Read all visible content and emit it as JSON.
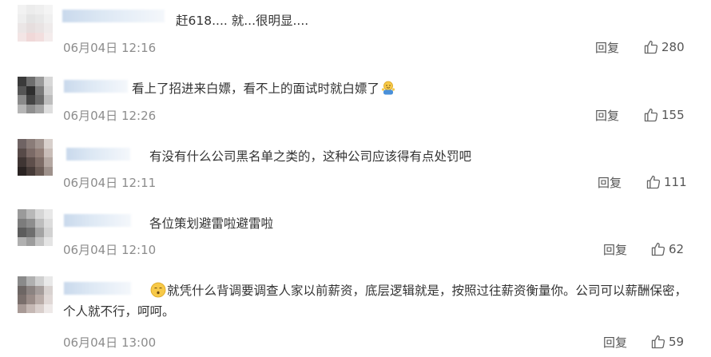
{
  "comments": [
    {
      "text": "赶618.... 就...很明显....",
      "time": "06月04日 12:16",
      "reply": "回复",
      "likes": "280"
    },
    {
      "text": "看上了招进来白嫖，看不上的面试时就白嫖了",
      "emoji": "shrug-emoji",
      "time": "06月04日 12:26",
      "reply": "回复",
      "likes": "155"
    },
    {
      "text": "有没有什么公司黑名单之类的，这种公司应该得有点处罚吧",
      "time": "06月04日 12:11",
      "reply": "回复",
      "likes": "111"
    },
    {
      "text": "各位策划避雷啦避雷啦",
      "time": "06月04日 12:10",
      "reply": "回复",
      "likes": "62"
    },
    {
      "emoji": "doubt-face-emoji",
      "text": "就凭什么背调要调查人家以前薪资，底层逻辑就是，按照过往薪资衡量你。公司可以薪酬保密，个人就不行，呵呵。",
      "time": "06月04日 13:00",
      "reply": "回复",
      "likes": "59"
    }
  ],
  "icons": {
    "like": "thumbs-up-icon"
  },
  "colors": {
    "text": "#333333",
    "muted": "#8c8c8c",
    "action": "#555555",
    "username": "#c9d9ec"
  }
}
